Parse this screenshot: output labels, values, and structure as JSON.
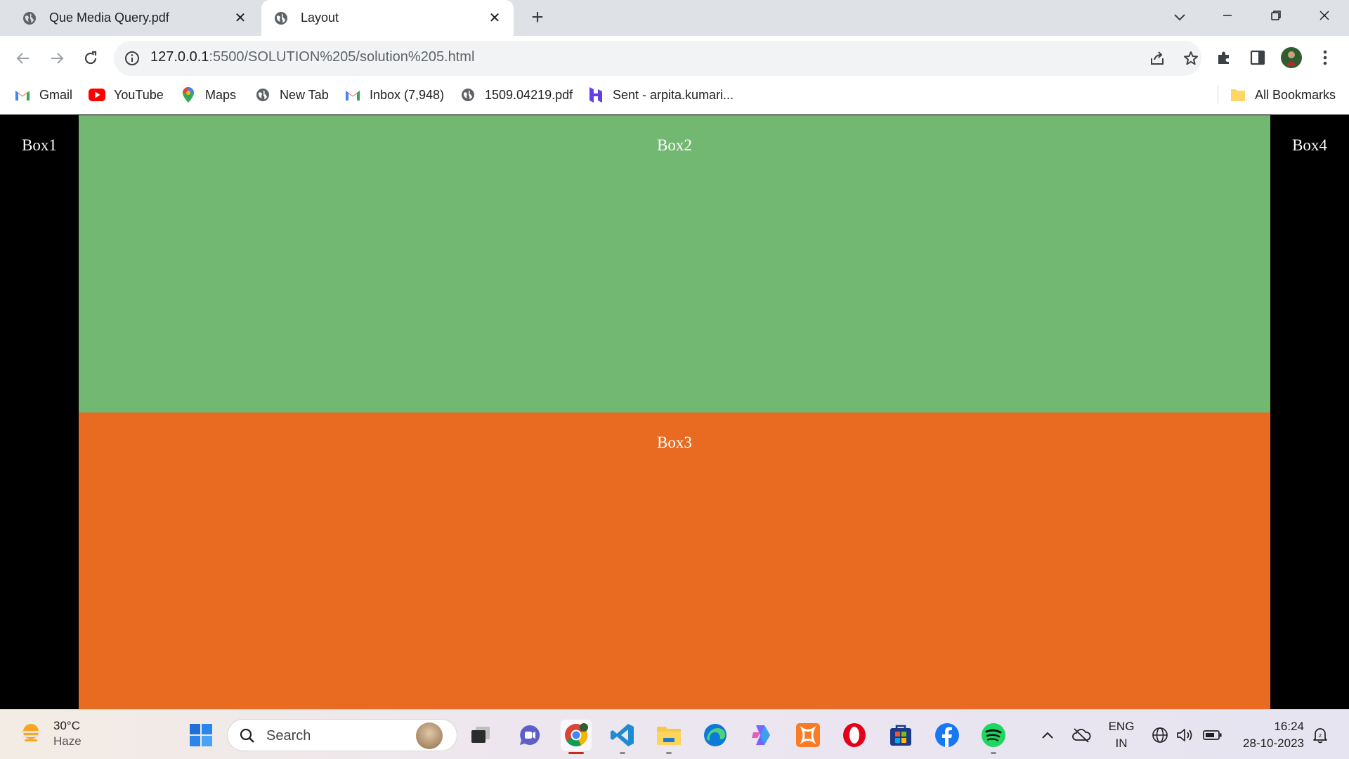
{
  "browser": {
    "tabs": [
      {
        "title": "Que Media Query.pdf",
        "active": false
      },
      {
        "title": "Layout",
        "active": true
      }
    ],
    "address_bar": {
      "host": "127.0.0.1",
      "path": ":5500/SOLUTION%205/solution%205.html"
    },
    "bookmarks": [
      {
        "label": "Gmail",
        "icon": "gmail-icon"
      },
      {
        "label": "YouTube",
        "icon": "youtube-icon"
      },
      {
        "label": "Maps",
        "icon": "maps-icon"
      },
      {
        "label": "New Tab",
        "icon": "globe-icon"
      },
      {
        "label": "Inbox (7,948)",
        "icon": "gmail-icon"
      },
      {
        "label": "1509.04219.pdf",
        "icon": "globe-icon"
      },
      {
        "label": "Sent - arpita.kumari...",
        "icon": "hostinger-icon"
      }
    ],
    "all_bookmarks_label": "All Bookmarks"
  },
  "page": {
    "box1": {
      "label": "Box1",
      "color": "#000000"
    },
    "box2": {
      "label": "Box2",
      "color": "#72b772"
    },
    "box3": {
      "label": "Box3",
      "color": "#e96a21"
    },
    "box4": {
      "label": "Box4",
      "color": "#000000"
    }
  },
  "taskbar": {
    "weather": {
      "temp": "30°C",
      "condition": "Haze"
    },
    "search_placeholder": "Search",
    "language": {
      "line1": "ENG",
      "line2": "IN"
    },
    "clock": {
      "time": "16:24",
      "date": "28-10-2023"
    }
  }
}
